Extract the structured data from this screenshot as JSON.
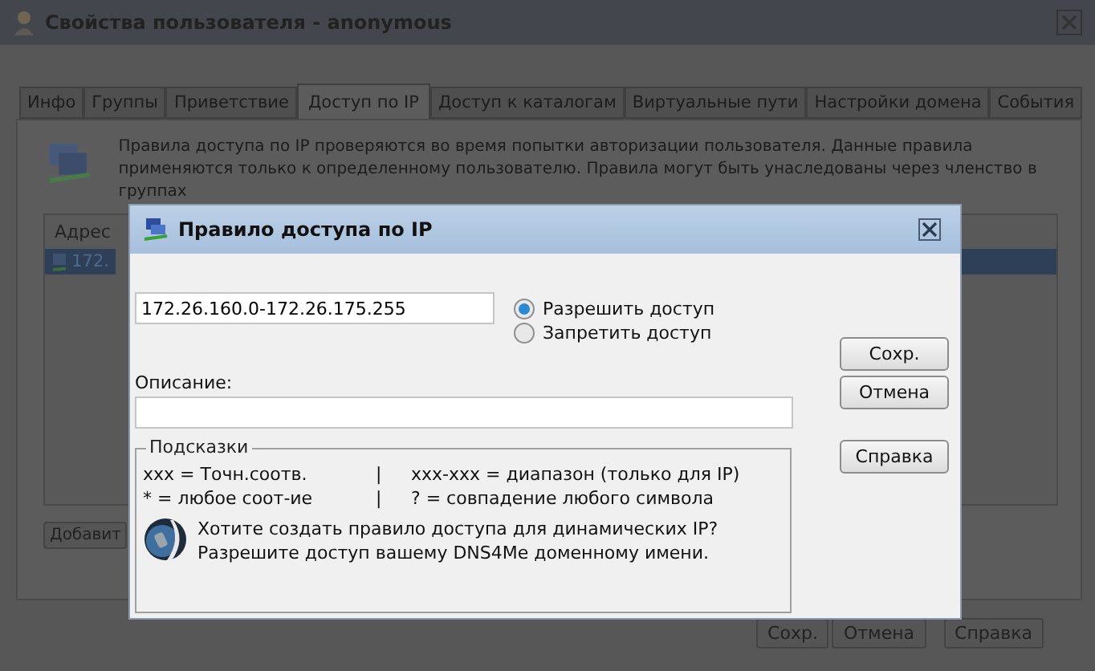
{
  "window": {
    "title": "Свойства пользователя - anonymous"
  },
  "tabs": [
    {
      "label": "Инфо",
      "selected": false
    },
    {
      "label": "Группы",
      "selected": false
    },
    {
      "label": "Приветствие",
      "selected": false
    },
    {
      "label": "Доступ по IP",
      "selected": true
    },
    {
      "label": "Доступ к каталогам",
      "selected": false
    },
    {
      "label": "Виртуальные пути",
      "selected": false
    },
    {
      "label": "Настройки домена",
      "selected": false
    },
    {
      "label": "События",
      "selected": false
    }
  ],
  "info_text": "Правила доступа по IP проверяются во время попытки авторизации пользователя. Данные правила применяются только к определенному пользователю. Правила могут быть унаследованы через членство в группах",
  "list": {
    "columns": [
      "Адрес"
    ],
    "rows": [
      {
        "address": "172.",
        "selected": true
      }
    ]
  },
  "add_button": "Добавит",
  "buttons": [
    "Сохр.",
    "Отмена",
    "Справка"
  ],
  "dialog": {
    "title": "Правило доступа по IP",
    "ip_value": "172.26.160.0-172.26.175.255",
    "access": [
      {
        "label": "Разрешить доступ",
        "selected": true
      },
      {
        "label": "Запретить доступ",
        "selected": false
      }
    ],
    "description_label": "Описание:",
    "hints": {
      "title": "Подсказки",
      "rows": [
        [
          "xxx = Точн.соотв.",
          "|",
          "xxx-xxx = диапазон (только для IP)"
        ],
        [
          "* = любое соот-ие",
          "|",
          "? = совпадение любого символа"
        ]
      ],
      "dns_text": "Хотите создать правило доступа для динамических IP? Разрешите доступ вашему DNS4Me доменному имени."
    },
    "buttons": [
      "Сохр.",
      "Отмена",
      "Справка"
    ]
  }
}
